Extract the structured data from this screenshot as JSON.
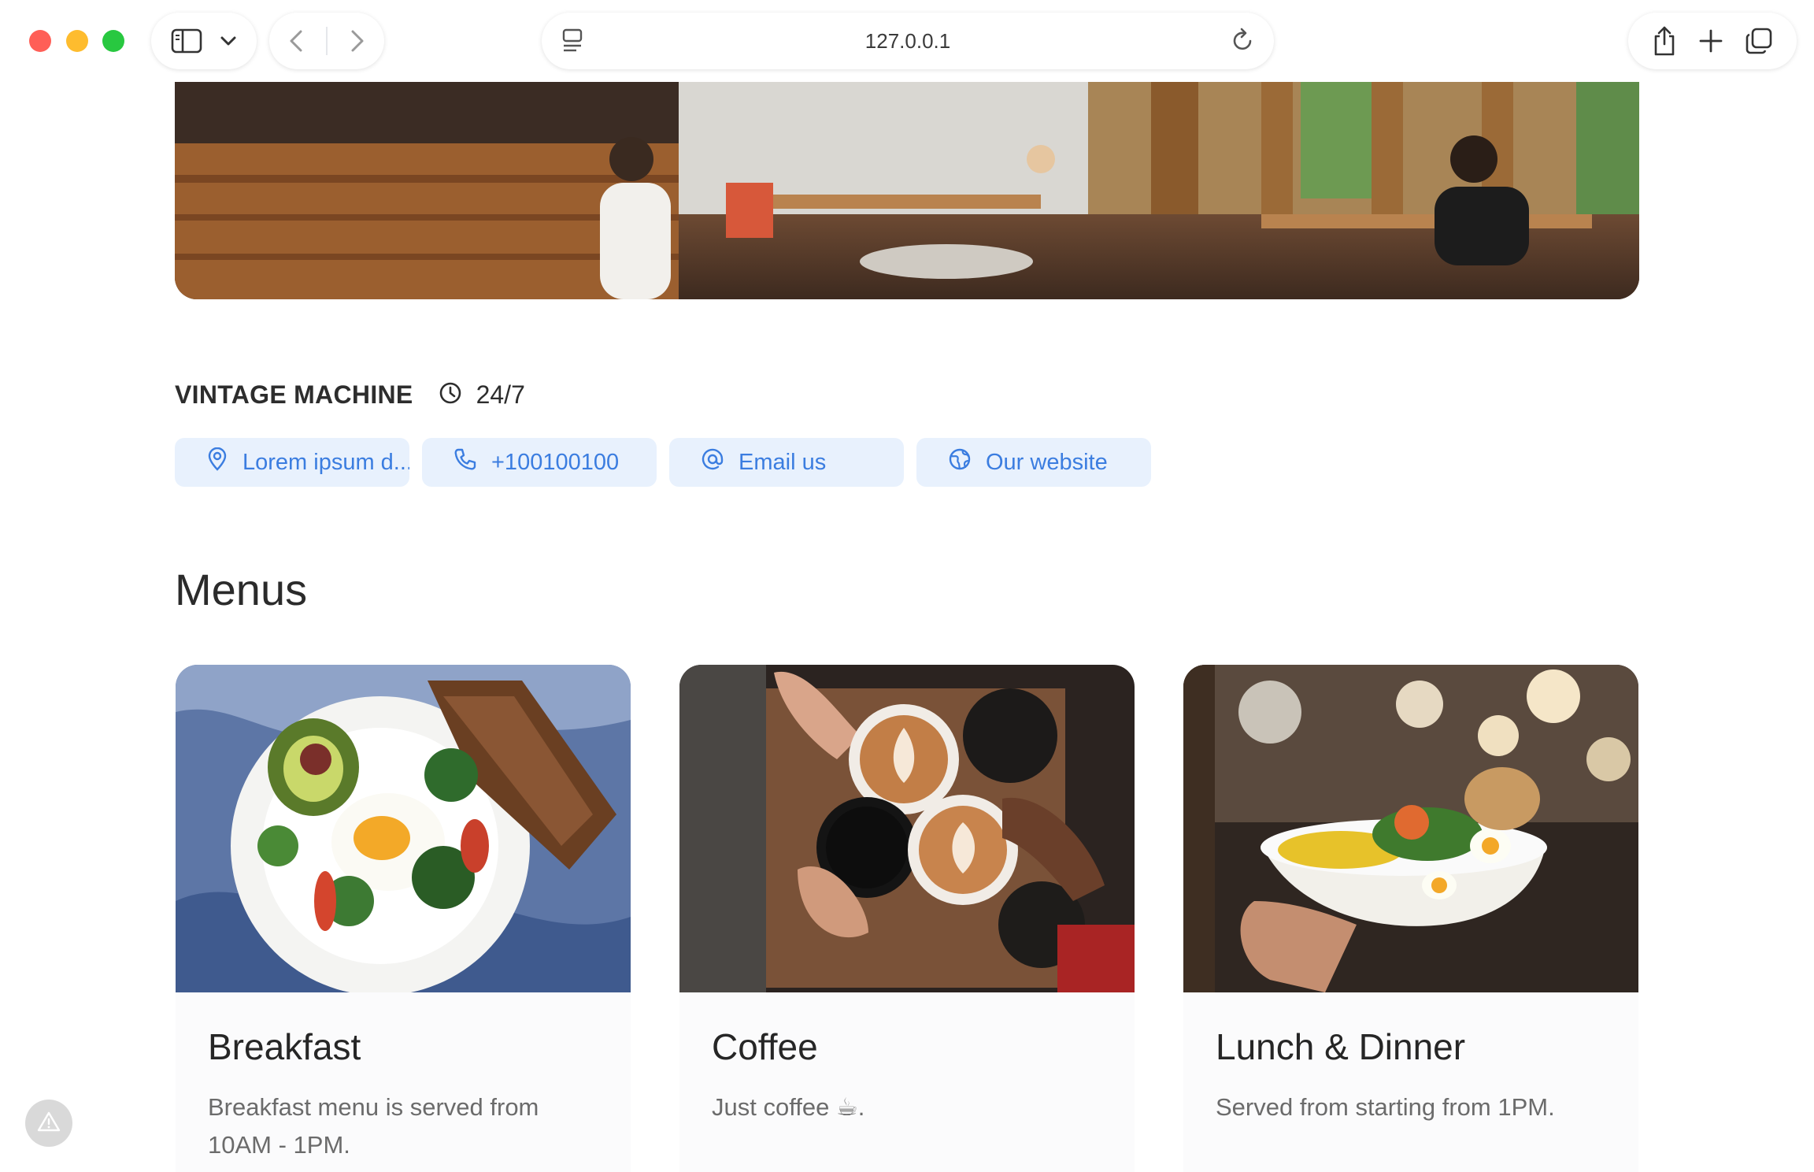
{
  "browser": {
    "url": "127.0.0.1"
  },
  "place": {
    "name": "VINTAGE MACHINE",
    "hours": "24/7"
  },
  "contacts": [
    {
      "label": "Lorem ipsum d...",
      "icon": "location-pin-icon"
    },
    {
      "label": "+100100100",
      "icon": "phone-icon"
    },
    {
      "label": "Email us",
      "icon": "at-sign-icon"
    },
    {
      "label": "Our website",
      "icon": "globe-icon"
    }
  ],
  "menus": {
    "heading": "Menus",
    "items": [
      {
        "title": "Breakfast",
        "description": "Breakfast menu is served from 10AM - 1PM."
      },
      {
        "title": "Coffee",
        "description": "Just coffee ☕."
      },
      {
        "title": "Lunch & Dinner",
        "description": "Served from starting from 1PM."
      }
    ]
  },
  "colors": {
    "chip_background": "#e8f1fd",
    "chip_text": "#3b7de0",
    "heading_text": "#2b2b2b"
  }
}
